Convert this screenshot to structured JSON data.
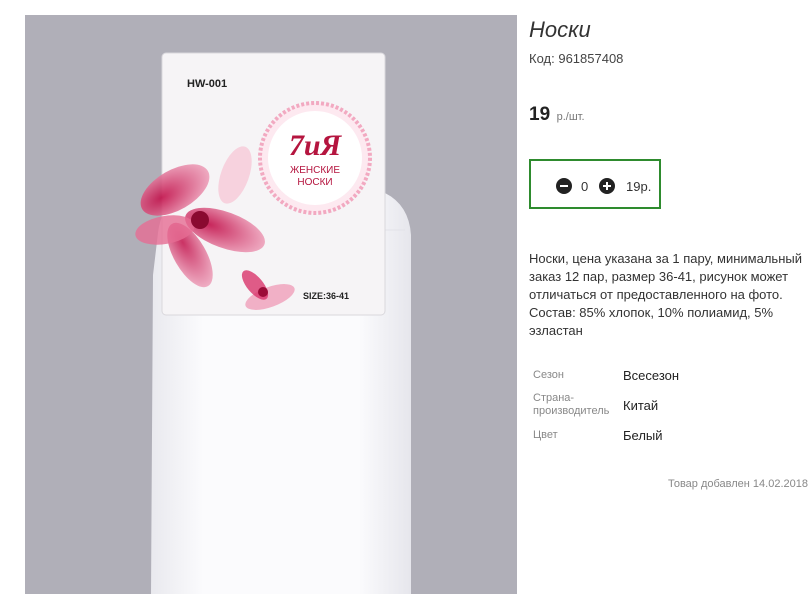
{
  "product": {
    "title": "Носки",
    "code_label": "Код:",
    "code": "961857408",
    "price": "19",
    "price_unit": "р./шт.",
    "quantity": "0",
    "total": "19р.",
    "description": "Носки, цена указана за 1 пару, минимальный заказ 12 пар, размер 36-41, рисунок может отличаться от предоставленного на фото. Состав: 85% хлопок, 10% полиамид, 5% эзластан",
    "properties": [
      {
        "label": "Сезон",
        "value": "Всесезон"
      },
      {
        "label": "Страна-производитель",
        "value": "Китай"
      },
      {
        "label": "Цвет",
        "value": "Белый"
      }
    ],
    "added": "Товар добавлен 14.02.2018"
  },
  "photo": {
    "model": "HW-001",
    "brand": "7иЯ",
    "brand_sub_1": "ЖЕНСКИЕ",
    "brand_sub_2": "НОСКИ",
    "size": "SIZE:36-41"
  },
  "colors": {
    "photo_bg": "#b0afb8",
    "accent_green": "#2e8b2e",
    "brand_red": "#b5153f",
    "flower_pink": "#d9346b"
  },
  "icons": {
    "minus": "minus-circle-icon",
    "plus": "plus-circle-icon"
  }
}
